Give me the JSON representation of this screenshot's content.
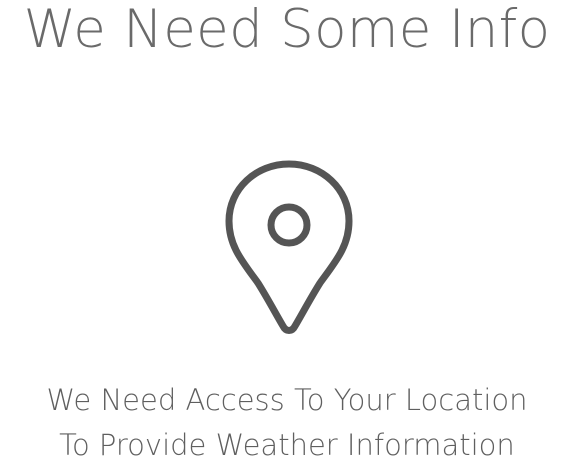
{
  "screen": {
    "title": "We Need Some Info",
    "icon": "location-pin-icon",
    "message": {
      "line1": "We Need Access To Your Location",
      "line2": "To Provide Weather Information"
    }
  },
  "colors": {
    "text": "#5f5f5f",
    "icon_stroke": "#555555",
    "background": "#ffffff"
  }
}
